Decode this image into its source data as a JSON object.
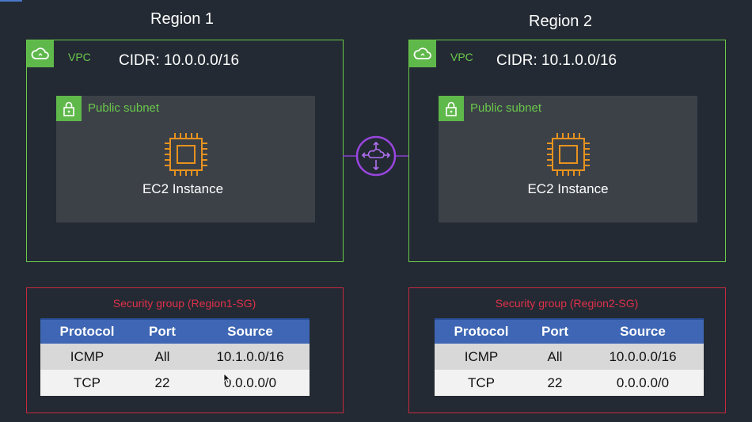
{
  "colors": {
    "background": "#232a33",
    "vpc_border": "#6ac84a",
    "security_group_border": "#c82840",
    "peering": "#8a3fd0",
    "ec2": "#e8921e",
    "table_header": "#3e66b4"
  },
  "regions": [
    {
      "title": "Region 1",
      "vpc": {
        "label": "VPC",
        "cidr": "CIDR: 10.0.0.0/16",
        "icon": "cloud-icon",
        "subnet": {
          "label": "Public subnet",
          "icon": "lock-icon",
          "instance_label": "EC2 Instance",
          "instance_icon": "ec2-chip-icon"
        }
      },
      "security_group": {
        "title": "Security group  (Region1-SG)",
        "headers": [
          "Protocol",
          "Port",
          "Source"
        ],
        "rows": [
          [
            "ICMP",
            "All",
            "10.1.0.0/16"
          ],
          [
            "TCP",
            "22",
            "0.0.0.0/0"
          ]
        ]
      }
    },
    {
      "title": "Region 2",
      "vpc": {
        "label": "VPC",
        "cidr": "CIDR: 10.1.0.0/16",
        "icon": "cloud-icon",
        "subnet": {
          "label": "Public subnet",
          "icon": "lock-icon",
          "instance_label": "EC2 Instance",
          "instance_icon": "ec2-chip-icon"
        }
      },
      "security_group": {
        "title": "Security group (Region2-SG)",
        "headers": [
          "Protocol",
          "Port",
          "Source"
        ],
        "rows": [
          [
            "ICMP",
            "All",
            "10.0.0.0/16"
          ],
          [
            "TCP",
            "22",
            "0.0.0.0/0"
          ]
        ]
      }
    }
  ],
  "peering": {
    "icon": "vpc-peering-icon"
  }
}
